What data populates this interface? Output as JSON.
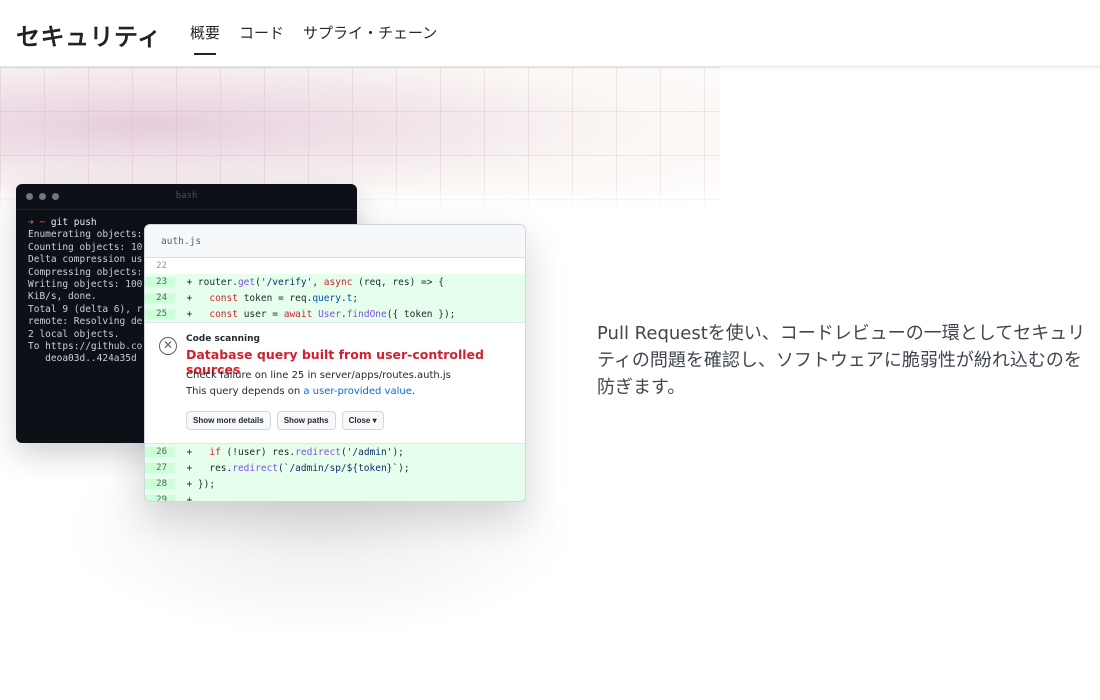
{
  "nav": {
    "brand": "セキュリティ",
    "links": [
      {
        "label": "概要",
        "active": true
      },
      {
        "label": "コード",
        "active": false
      },
      {
        "label": "サプライ・チェーン",
        "active": false
      }
    ]
  },
  "terminal": {
    "title": "bash",
    "prompt": "➜ ~ ",
    "command": "git push",
    "lines": [
      "Enumerating objects:",
      "Counting objects: 10",
      "Delta compression us",
      "Compressing objects:",
      "Writing objects: 100",
      "KiB/s, done.",
      "Total 9 (delta 6), r",
      "remote: Resolving de",
      "2 local objects.",
      "To https://github.co",
      "   deoa03d..424a35d"
    ]
  },
  "code_card": {
    "filename": "auth.js",
    "rows_top": [
      {
        "ln": "22",
        "mark": "",
        "code": ""
      },
      {
        "ln": "23",
        "mark": "+",
        "code": "router.get('/verify', async (req, res) => {"
      },
      {
        "ln": "24",
        "mark": "+",
        "code": "  const token = req.query.t;"
      },
      {
        "ln": "25",
        "mark": "+",
        "code": "  const user = await User.findOne({ token });"
      }
    ],
    "alert": {
      "kicker": "Code scanning",
      "title": "Database query built from user-controlled sources",
      "desc_line1": "Check failure on line 25 in server/apps/routes.auth.js",
      "desc_line2_prefix": "This query depends on ",
      "desc_line2_link": "a user-provided value",
      "desc_line2_suffix": ".",
      "buttons": [
        "Show more details",
        "Show paths",
        "Close ▾"
      ]
    },
    "rows_bottom": [
      {
        "ln": "26",
        "mark": "+",
        "code": "  if (!user) res.redirect('/admin');"
      },
      {
        "ln": "27",
        "mark": "+",
        "code": "  res.redirect(`/admin/sp/${token}`);"
      },
      {
        "ln": "28",
        "mark": "+",
        "code": "});"
      },
      {
        "ln": "29",
        "mark": "+",
        "code": ""
      }
    ]
  },
  "copy": {
    "text": "Pull Requestを使い、コードレビューの一環としてセキュリティの問題を確認し、ソフトウェアに脆弱性が紛れ込むのを防ぎます。"
  },
  "colors": {
    "alert_red": "#cf222e",
    "link_blue": "#0969da",
    "added_line_bg": "#e6ffec",
    "terminal_bg": "#0d1117"
  }
}
